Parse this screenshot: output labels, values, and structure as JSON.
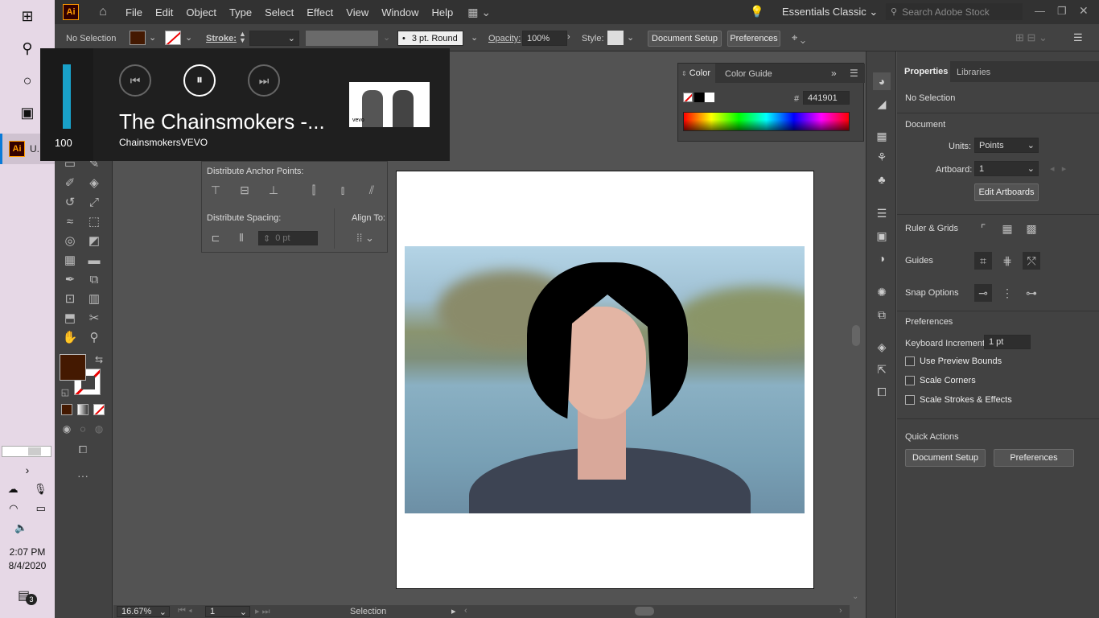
{
  "taskbar": {
    "time": "2:07 PM",
    "date": "8/4/2020",
    "app_label": "U.",
    "notification_count": "3",
    "app_logo": "Ai"
  },
  "menu": {
    "logo": "Ai",
    "items": [
      "File",
      "Edit",
      "Object",
      "Type",
      "Select",
      "Effect",
      "View",
      "Window",
      "Help"
    ],
    "workspace": "Essentials Classic",
    "search_placeholder": "Search Adobe Stock"
  },
  "control": {
    "selection": "No Selection",
    "stroke_label": "Stroke:",
    "brush": "3 pt. Round",
    "opacity_label": "Opacity:",
    "opacity": "100%",
    "style_label": "Style:",
    "document_setup": "Document Setup",
    "preferences": "Preferences",
    "fill_color": "#441901"
  },
  "media": {
    "volume": "100",
    "title": "The Chainsmokers -...",
    "artist": "ChainsmokersVEVO",
    "thumb_label": "vevo"
  },
  "align": {
    "distribute_anchor": "Distribute Anchor Points:",
    "distribute_spacing": "Distribute Spacing:",
    "align_to": "Align To:",
    "spacing_value": "0 pt"
  },
  "colorpanel": {
    "tab_color": "Color",
    "tab_guide": "Color Guide",
    "hex_label": "#",
    "hex": "441901"
  },
  "properties": {
    "tab_properties": "Properties",
    "tab_libraries": "Libraries",
    "no_selection": "No Selection",
    "document": "Document",
    "units_label": "Units:",
    "units": "Points",
    "artboard_label": "Artboard:",
    "artboard": "1",
    "edit_artboards": "Edit Artboards",
    "ruler_grids": "Ruler & Grids",
    "guides": "Guides",
    "snap_options": "Snap Options",
    "preferences": "Preferences",
    "keyboard_label": "Keyboard Increment:",
    "keyboard": "1 pt",
    "use_preview_bounds": "Use Preview Bounds",
    "scale_corners": "Scale Corners",
    "scale_strokes": "Scale Strokes & Effects",
    "quick_actions": "Quick Actions",
    "document_setup": "Document Setup",
    "preferences_btn": "Preferences"
  },
  "status": {
    "zoom": "16.67%",
    "artboard": "1",
    "tool": "Selection"
  }
}
